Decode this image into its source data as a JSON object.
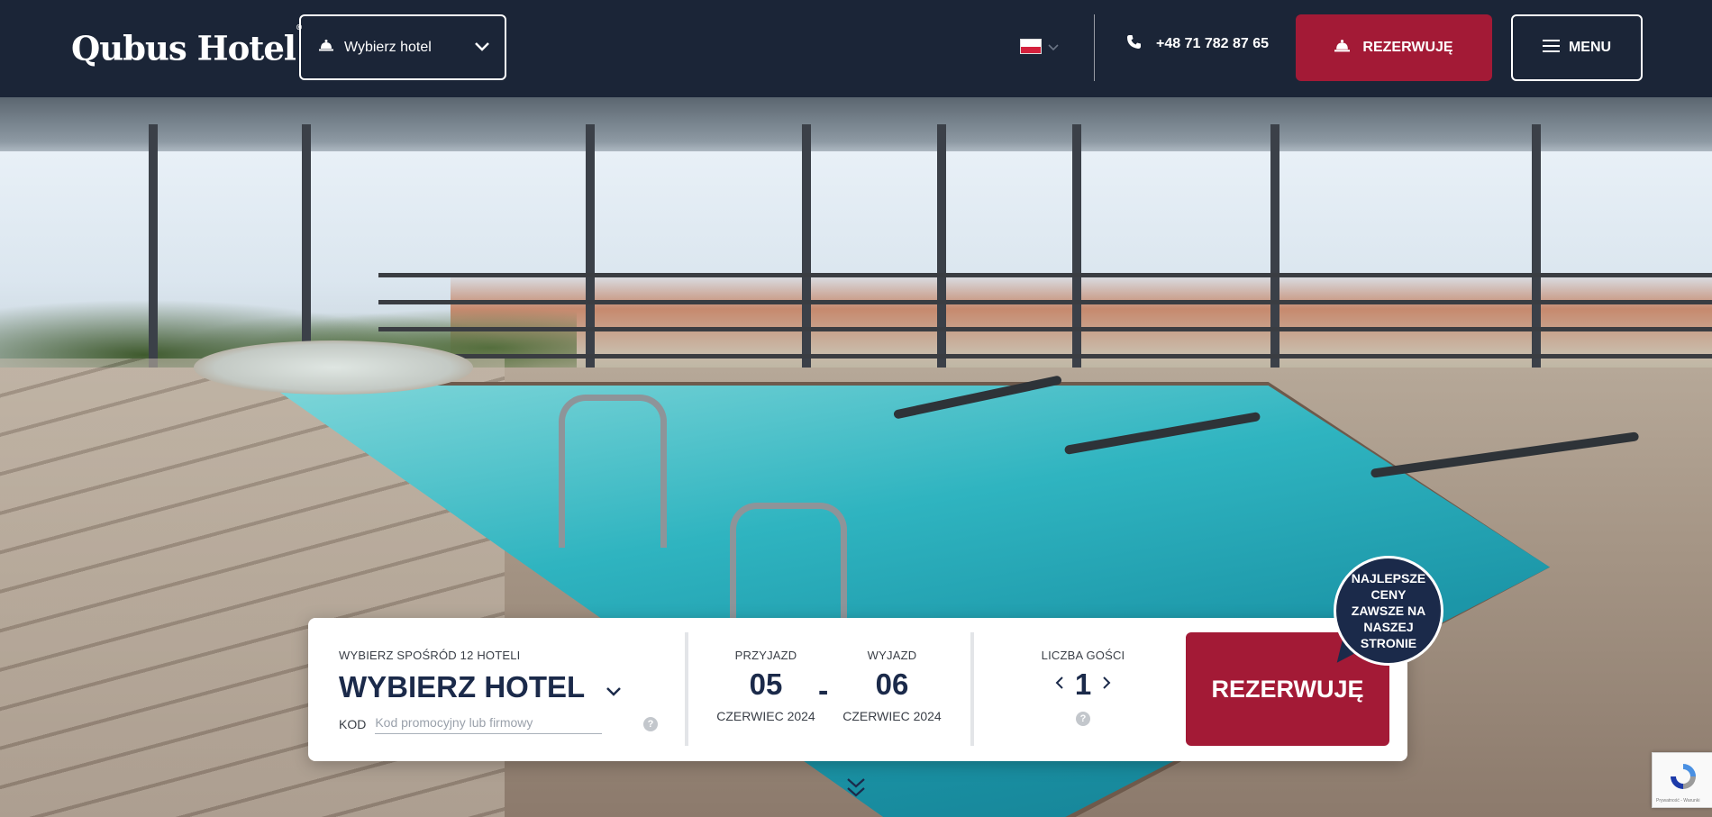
{
  "header": {
    "logo_text": "Qubus Hotel",
    "logo_mark": "®",
    "hotel_select_label": "Wybierz hotel",
    "language_flag": "poland-flag",
    "phone": "+48 71 782 87 65",
    "book_button_label": "REZERWUJĘ",
    "menu_button_label": "MENU"
  },
  "booking": {
    "hotel_caption": "WYBIERZ SPOŚRÓD 12 HOTELI",
    "hotel_value": "WYBIERZ HOTEL",
    "code_label": "KOD",
    "code_placeholder": "Kod promocyjny lub firmowy",
    "help_glyph": "?",
    "arrival": {
      "label": "PRZYJAZD",
      "day": "05",
      "month": "CZERWIEC 2024"
    },
    "separator": "-",
    "departure": {
      "label": "WYJAZD",
      "day": "06",
      "month": "CZERWIEC 2024"
    },
    "guests": {
      "label": "LICZBA GOŚCI",
      "count": "1"
    },
    "book_button_label": "REZERWUJĘ",
    "badge_text": "NAJLEPSZE CENY ZAWSZE NA NASZEJ STRONIE"
  },
  "recaptcha": {
    "text": "Prywatność - Warunki"
  },
  "colors": {
    "navy": "#1b2537",
    "accent_red": "#a31a36",
    "text_navy": "#1b2a4a"
  },
  "icons": [
    "bell-icon",
    "chevron-down-icon",
    "phone-icon",
    "hamburger-icon",
    "chevron-left-icon",
    "chevron-right-icon",
    "help-icon",
    "scroll-down-icon",
    "recaptcha-icon"
  ]
}
